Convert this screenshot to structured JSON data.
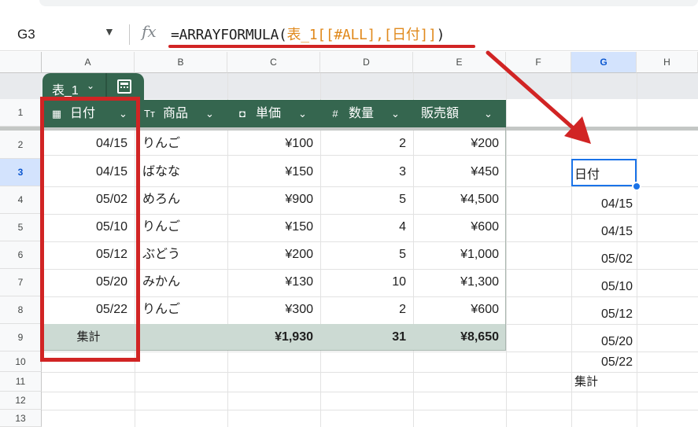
{
  "formula_bar": {
    "name_box": "G3",
    "dropdown_glyph": "▼",
    "fx_glyph": "fx",
    "formula_parts": [
      "=ARRAYFORMULA(",
      "表_1[[#ALL],[日付]]",
      ")"
    ]
  },
  "columns": [
    "A",
    "B",
    "C",
    "D",
    "E",
    "F",
    "G",
    "H"
  ],
  "rows": [
    "1",
    "2",
    "3",
    "4",
    "5",
    "6",
    "7",
    "8",
    "9",
    "10",
    "11",
    "12",
    "13"
  ],
  "selected_column": "G",
  "selected_row": "3",
  "table": {
    "name": "表_1",
    "dropdown_glyph": "⌄",
    "headers": [
      {
        "icon": "calendar-icon",
        "glyph": "▦",
        "label": "日付"
      },
      {
        "icon": "text-type-icon",
        "glyph": "Tт",
        "label": "商品"
      },
      {
        "icon": "currency-icon",
        "glyph": "◘",
        "label": "単価"
      },
      {
        "icon": "number-icon",
        "glyph": "#",
        "label": "数量"
      },
      {
        "icon": "none",
        "glyph": "",
        "label": "販売額"
      }
    ],
    "header_chevron": "⌄",
    "rows": [
      [
        "04/15",
        "りんご",
        "¥100",
        "2",
        "¥200"
      ],
      [
        "04/15",
        "ばなな",
        "¥150",
        "3",
        "¥450"
      ],
      [
        "05/02",
        "めろん",
        "¥900",
        "5",
        "¥4,500"
      ],
      [
        "05/10",
        "りんご",
        "¥150",
        "4",
        "¥600"
      ],
      [
        "05/12",
        "ぶどう",
        "¥200",
        "5",
        "¥1,000"
      ],
      [
        "05/20",
        "みかん",
        "¥130",
        "10",
        "¥1,300"
      ],
      [
        "05/22",
        "りんご",
        "¥300",
        "2",
        "¥600"
      ]
    ],
    "total_row": [
      "集計",
      "",
      "¥1,930",
      "31",
      "¥8,650"
    ]
  },
  "g_column_values": [
    "日付",
    "04/15",
    "04/15",
    "05/02",
    "05/10",
    "05/12",
    "05/20",
    "05/22",
    "集計"
  ],
  "colors": {
    "table_header": "#35664f",
    "total_row": "#ccdad3",
    "annotation_red": "#d12424",
    "selection_blue": "#1a73e8",
    "formula_range": "#e0891c"
  }
}
